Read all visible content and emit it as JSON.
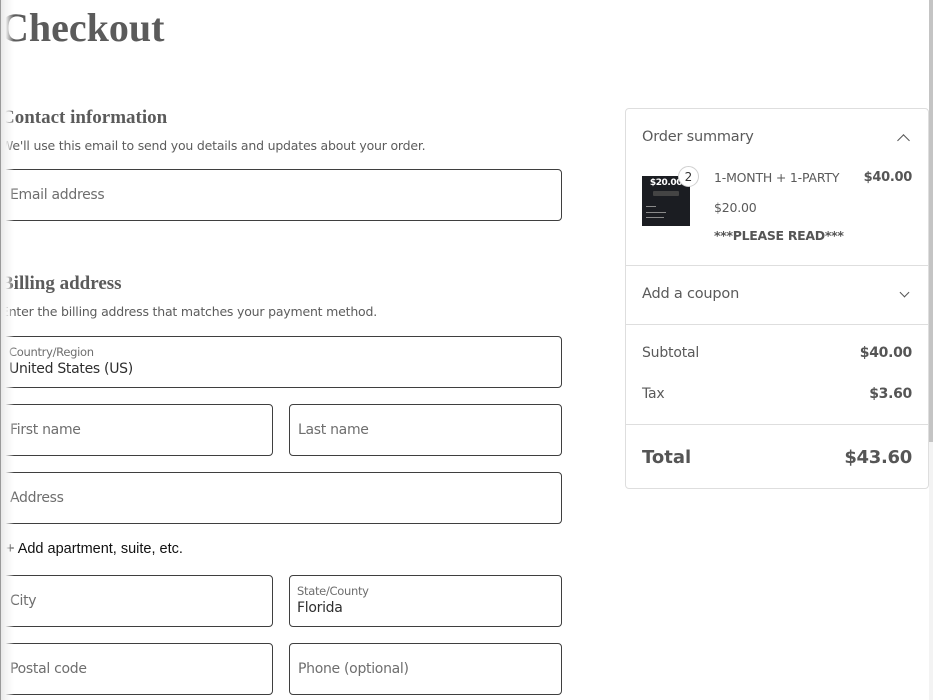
{
  "page": {
    "title": "Checkout"
  },
  "contact": {
    "heading": "Contact information",
    "description": "We'll use this email to send you details and updates about your order.",
    "email_placeholder": "Email address",
    "email_value": ""
  },
  "billing": {
    "heading": "Billing address",
    "description": "Enter the billing address that matches your payment method.",
    "country": {
      "label": "Country/Region",
      "value": "United States (US)"
    },
    "first_name_placeholder": "First name",
    "last_name_placeholder": "Last name",
    "address_placeholder": "Address",
    "add_apartment_label": "+ Add apartment, suite, etc.",
    "city_placeholder": "City",
    "state": {
      "label": "State/County",
      "value": "Florida"
    },
    "postal_code_placeholder": "Postal code",
    "phone_placeholder": "Phone (optional)"
  },
  "summary": {
    "title": "Order summary",
    "toggle_icon": "chevron-up-icon",
    "items": [
      {
        "quantity": "2",
        "name": "1-MONTH + 1-PARTY",
        "line_total": "$40.00",
        "unit_price": "$20.00",
        "note": "***PLEASE READ***",
        "thumbnail_price": "$20.00"
      }
    ],
    "coupon_label": "Add a coupon",
    "coupon_icon": "chevron-down-icon",
    "subtotal_label": "Subtotal",
    "subtotal_value": "$40.00",
    "tax_label": "Tax",
    "tax_value": "$3.60",
    "total_label": "Total",
    "total_value": "$43.60"
  }
}
